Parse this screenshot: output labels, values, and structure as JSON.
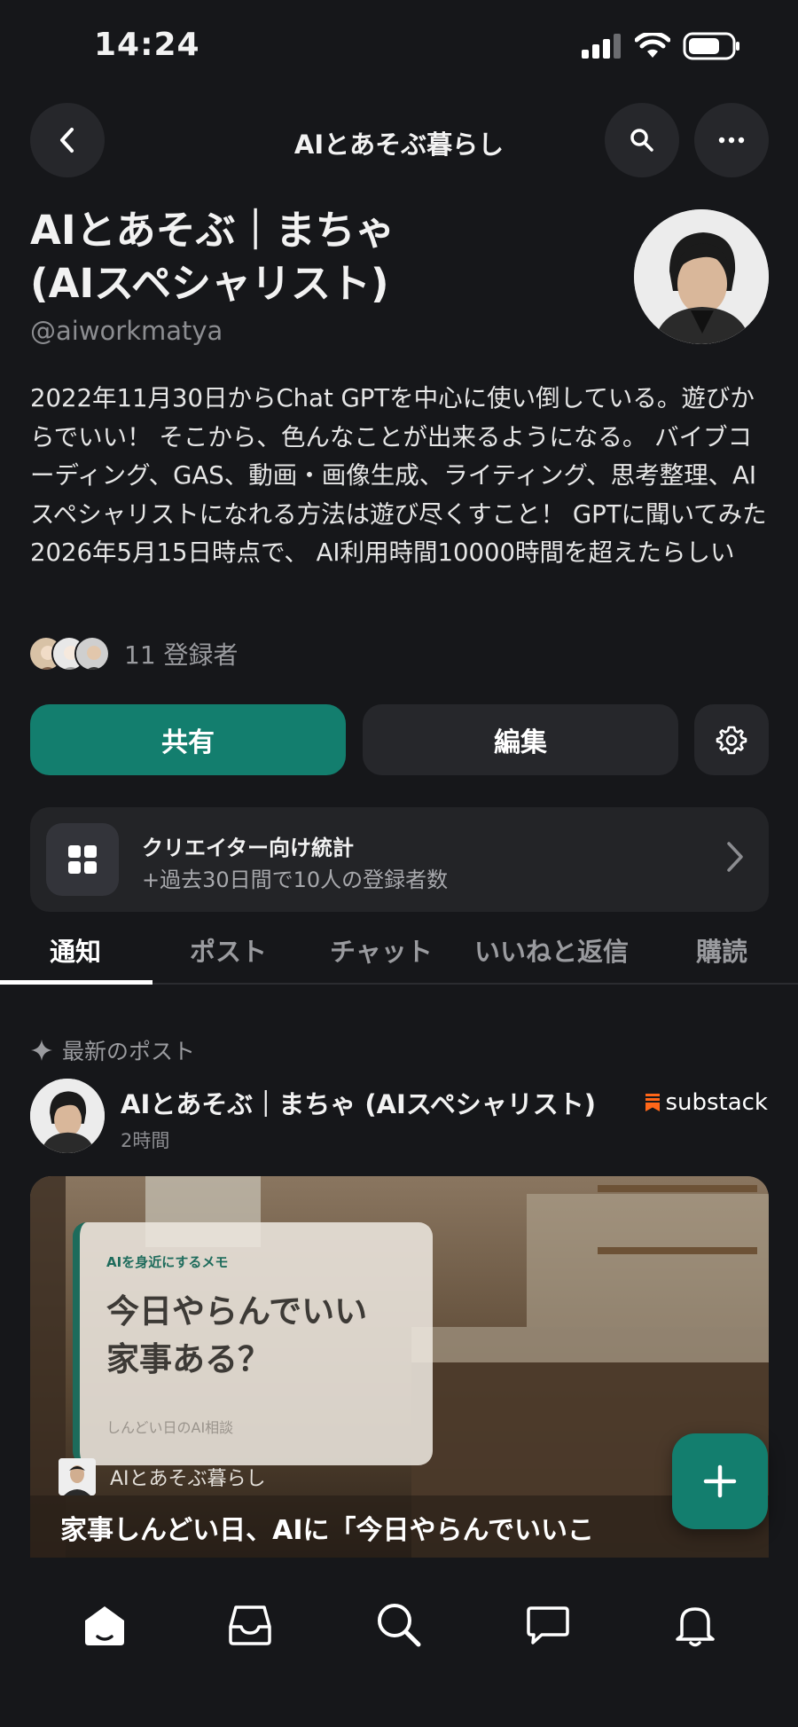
{
  "status_bar": {
    "time": "14:24"
  },
  "header": {
    "title": "AIとあそぶ暮らし"
  },
  "profile": {
    "name_line1": "AIとあそぶ｜まちゃ",
    "name_line2": "(AIスペシャリスト)",
    "handle": "@aiworkmatya",
    "bio": "2022年11月30日からChat GPTを中心に使い倒している。遊びからでいい！ そこから、色んなことが出来るようになる。 バイブコーディング、GAS、動画・画像生成、ライティング、思考整理、AIスペシャリストになれる方法は遊び尽くすこと！ GPTに聞いてみた 2026年5月15日時点で、 AI利用時間10000時間を超えたらしい",
    "subscribers": "11 登録者"
  },
  "actions": {
    "share": "共有",
    "edit": "編集"
  },
  "stats_card": {
    "title": "クリエイター向け統計",
    "subtitle": "+過去30日間で10人の登録者数"
  },
  "tabs": [
    "通知",
    "ポスト",
    "チャット",
    "いいねと返信",
    "購読"
  ],
  "active_tab": "通知",
  "feed": {
    "section_label": "最新のポスト",
    "post": {
      "author": "AIとあそぶ｜まちゃ (AIスペシャリスト)",
      "time": "2時間",
      "source": "substack",
      "card": {
        "kicker": "AIを身近にするメモ",
        "title_line1": "今日やらんでいい",
        "title_line2": "家事ある？",
        "subtitle": "しんどい日のAI相談",
        "publication": "AIとあそぶ暮らし",
        "headline": "家事しんどい日、AIに「今日やらんでいいこ"
      }
    }
  },
  "bottom_nav": [
    "home-icon",
    "inbox-icon",
    "search-icon",
    "chat-icon",
    "bell-icon"
  ],
  "colors": {
    "accent": "#137e6e",
    "background": "#16171a",
    "surface": "#26272b",
    "substack_orange": "#ff6719"
  }
}
